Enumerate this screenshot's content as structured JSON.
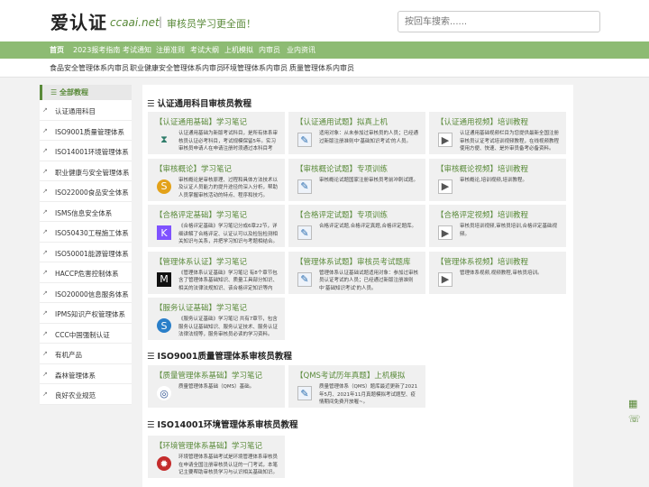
{
  "header": {
    "logo_cn": "爱认证",
    "logo_en": "ccaai.net",
    "logo_sep": "|",
    "slogan": "审核员学习更全面！",
    "search_placeholder": "按回车搜索......"
  },
  "nav": [
    "首页",
    "2023报考指南",
    "考试通知",
    "注册准则",
    "考试大纲",
    "上机模拟",
    "内审员",
    "业内资讯"
  ],
  "subnav": [
    "食品安全管理体系内审员",
    "职业健康安全管理体系内审员",
    "环境管理体系内审员",
    "质量管理体系内审员"
  ],
  "sidebar": {
    "heading": "全部教程",
    "items": [
      "认证通用科目",
      "ISO9001质量管理体系",
      "ISO14001环境管理体系",
      "职业健康与安全管理体系",
      "ISO22000食品安全体系",
      "ISMS信息安全体系",
      "ISO50430工程施工体系",
      "ISO50001能源管理体系",
      "HACCP危害控制体系",
      "ISO20000信息服务体系",
      "IPMS知识产权管理体系",
      "CCC中国强制认证",
      "有机产品",
      "森林管理体系",
      "良好农业规范"
    ]
  },
  "sections": [
    {
      "title": "认证通用科目审核员教程",
      "cards": [
        {
          "title": "【认证通用基础】学习笔记",
          "icon": "hourglass-icon",
          "desc": "认证通用基础为新版考试科目，是所有体系审核员认证必考科目，考试规模保留5年。实习审核员申请人在申请注册时须通过本科目考试。"
        },
        {
          "title": "【认证通用试题】拟真上机",
          "icon": "edit-icon",
          "desc": "适用对象：从未参加过审核员的人员；已经通过新版注册准则中'基础知识考试'的人员。"
        },
        {
          "title": "【认证通用视频】培训教程",
          "icon": "video-icon",
          "desc": "认证通用基础视频栏目为您提供最新全国注册审核员认证考试培训视频教程，在线视频教程使用方便、快速、是外审员备考必备资料。"
        },
        {
          "title": "【审核概论】学习笔记",
          "icon": "coin-icon",
          "desc": "审核概论是审核原理、过程和具体方法技术以及认证人员能力的提升途径的深入分析，帮助人员掌握审核活动的特点、程序和技巧。"
        },
        {
          "title": "【审核概论试题】专项训练",
          "icon": "edit-icon",
          "desc": "审核概论试题国家注册审核员考前冲刺试题。"
        },
        {
          "title": "【审核概论视频】培训教程",
          "icon": "video-icon",
          "desc": "审核概论,培训视频,培训教程。"
        },
        {
          "title": "【合格评定基础】学习笔记",
          "icon": "kotlin-icon",
          "desc": "《合格评定基础》学习笔记分成6章22节，详细讲解了合格评定、认证认可以及检验检测相关知识与关系，并把学习知识与考题相结合。"
        },
        {
          "title": "【合格评定试题】专项训练",
          "icon": "edit-icon",
          "desc": "合格评定试题,合格评定真题,合格评定题库。"
        },
        {
          "title": "【合格评定视频】培训教程",
          "icon": "video-icon",
          "desc": "审核员培训视频,审核员培训,合格评定基础视频。"
        },
        {
          "title": "【管理体系认证】学习笔记",
          "icon": "medium-icon",
          "desc": "《管理体系认证基础》学习笔记 有8个章节包含了管理体系基础知识、质量工具部分知识、相关的法律法规知识、该合格评定知识等内容。"
        },
        {
          "title": "【管理体系试题】审核员考试题库",
          "icon": "edit-icon",
          "desc": "管理体系认证基础试题适用对象：参加过审核员认证考试的人员；已经通过新版注册准则中'基础知识考试'的人员。"
        },
        {
          "title": "【管理体系视频】培训教程",
          "icon": "video-icon",
          "desc": "管理体系视频,视频教程,审核员培训。"
        },
        {
          "title": "【服务认证基础】学习笔记",
          "icon": "s-icon",
          "desc": "《服务认证基础》学习笔记 共有7章节，包含服务认证基础知识、服务认证技术、服务认证法律法规等，服务审核员必读的学习资料。"
        }
      ]
    },
    {
      "title": "ISO9001质量管理体系审核员教程",
      "cards": [
        {
          "title": "【质量管理体系基础】学习笔记",
          "icon": "iso-icon",
          "desc": "质量管理体系基础（QMS）基础。"
        },
        {
          "title": "【QMS考试历年真题】上机模拟",
          "icon": "edit-icon",
          "desc": "质量管理体系（QMS）题库最近更新了2021年5月、2021年11月真题模拟考试题型、疫情期间免费开放喔~。"
        }
      ]
    },
    {
      "title": "ISO14001环境管理体系审核员教程",
      "cards": [
        {
          "title": "【环境管理体系基础】学习笔记",
          "icon": "stamp-icon",
          "desc": "环境管理体系基础考试是环境管理体系审核员在申请全国注册审核员认证的一门考试，本笔记主要帮助审核员学习与认识相关基础知识。"
        }
      ]
    }
  ],
  "colors": {
    "green": "#8dbb73",
    "dark_green": "#5a8a3a"
  }
}
